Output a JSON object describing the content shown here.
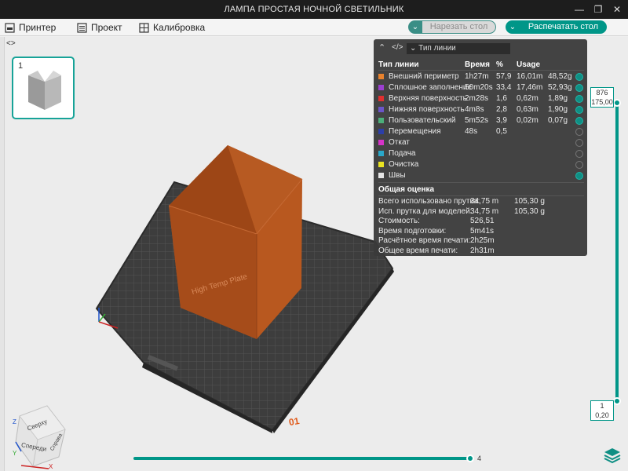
{
  "window": {
    "title": "ЛАМПА ПРОСТАЯ НОЧНОЙ СВЕТИЛЬНИК"
  },
  "menu": {
    "printer": "Принтер",
    "project": "Проект",
    "calibration": "Калибровка",
    "slice_button": "Нарезать стол",
    "print_button": "Распечатать стол"
  },
  "plate_list": {
    "plate_number": "1"
  },
  "stats": {
    "type_selector": "Тип линии",
    "headers": {
      "type": "Тип линии",
      "time": "Время",
      "percent": "%",
      "usage": "Usage"
    },
    "rows": [
      {
        "name": "Внешний периметр",
        "time": "1h27m",
        "percent": "57,9",
        "usage": "16,01m",
        "weight": "48,52g",
        "color": "#e8822d",
        "visible": true
      },
      {
        "name": "Сплошное заполнение",
        "time": "50m20s",
        "percent": "33,4",
        "usage": "17,46m",
        "weight": "52,93g",
        "color": "#9b3fd1",
        "visible": true
      },
      {
        "name": "Верхняя поверхность",
        "time": "2m28s",
        "percent": "1,6",
        "usage": "0,62m",
        "weight": "1,89g",
        "color": "#e03030",
        "visible": true
      },
      {
        "name": "Нижняя поверхность",
        "time": "4m8s",
        "percent": "2,8",
        "usage": "0,63m",
        "weight": "1,90g",
        "color": "#6b55c9",
        "visible": true
      },
      {
        "name": "Пользовательский",
        "time": "5m52s",
        "percent": "3,9",
        "usage": "0,02m",
        "weight": "0,07g",
        "color": "#4caf7a",
        "visible": true
      },
      {
        "name": "Перемещения",
        "time": "48s",
        "percent": "0,5",
        "usage": "",
        "weight": "",
        "color": "#2c3fa8",
        "visible": false
      },
      {
        "name": "Откат",
        "time": "",
        "percent": "",
        "usage": "",
        "weight": "",
        "color": "#d633c8",
        "visible": false
      },
      {
        "name": "Подача",
        "time": "",
        "percent": "",
        "usage": "",
        "weight": "",
        "color": "#29a7c9",
        "visible": false
      },
      {
        "name": "Очистка",
        "time": "",
        "percent": "",
        "usage": "",
        "weight": "",
        "color": "#e9e321",
        "visible": false
      },
      {
        "name": "Швы",
        "time": "",
        "percent": "",
        "usage": "",
        "weight": "",
        "color": "#e6e6e6",
        "visible": true
      }
    ],
    "estimate": {
      "title": "Общая оценка",
      "items": [
        {
          "label": "Всего использовано прутка:",
          "v1": "34,75 m",
          "v2": "105,30 g"
        },
        {
          "label": "Исп. прутка для моделей:",
          "v1": "34,75 m",
          "v2": "105,30 g"
        },
        {
          "label": "Стоимость:",
          "v1": "526,51",
          "v2": ""
        },
        {
          "label": "Время подготовки:",
          "v1": "5m41s",
          "v2": ""
        },
        {
          "label": "Расчётное время печати:",
          "v1": "2h25m",
          "v2": ""
        },
        {
          "label": "Общее время печати:",
          "v1": "2h31m",
          "v2": ""
        }
      ]
    }
  },
  "layer_slider": {
    "top_layer": "876",
    "top_height": "175,00",
    "bottom_layer": "1",
    "bottom_height": "0,20"
  },
  "move_slider": {
    "value": "4"
  },
  "plate_label": "01",
  "plate_text": "High Temp Plate",
  "view_cube": {
    "top": "Сверху",
    "front": "Спереди",
    "right": "Справа"
  },
  "axes": {
    "x": "X",
    "y": "Y",
    "z": "Z"
  },
  "colors": {
    "accent": "#009688",
    "model": "#b0531f",
    "panel": "#3a3a3a"
  }
}
